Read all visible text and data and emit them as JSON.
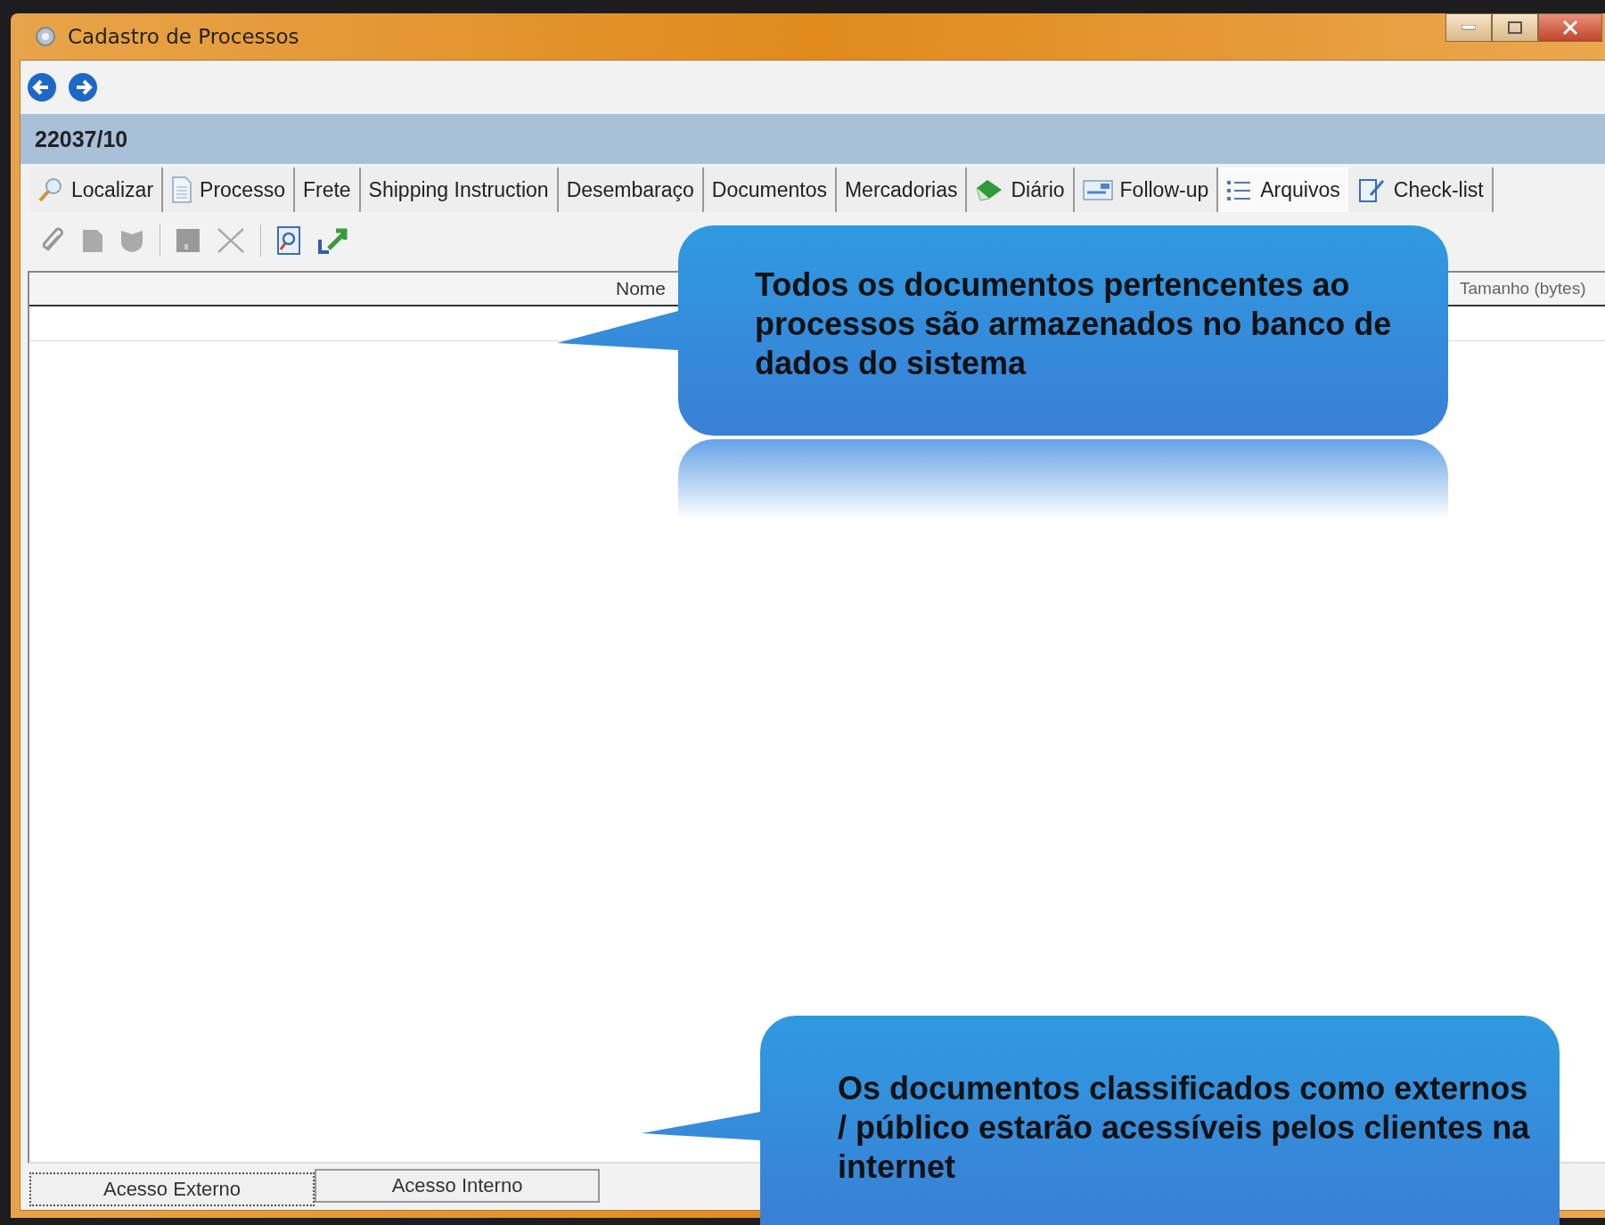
{
  "window": {
    "title": "Cadastro de Processos"
  },
  "process_number": "22037/10",
  "tabs": [
    {
      "label": "Localizar",
      "selected": false
    },
    {
      "label": "Processo",
      "selected": false
    },
    {
      "label": "Frete",
      "selected": false
    },
    {
      "label": "Shipping Instruction",
      "selected": false
    },
    {
      "label": "Desembaraço",
      "selected": false
    },
    {
      "label": "Documentos",
      "selected": false
    },
    {
      "label": "Mercadorias",
      "selected": false
    },
    {
      "label": "Diário",
      "selected": false
    },
    {
      "label": "Follow-up",
      "selected": false
    },
    {
      "label": "Arquivos",
      "selected": true
    },
    {
      "label": "Check-list",
      "selected": false
    }
  ],
  "table": {
    "columns": [
      "Nome",
      "Tamanho (bytes)"
    ]
  },
  "bottom_tabs": [
    {
      "label": "Acesso Externo",
      "selected": true
    },
    {
      "label": "Acesso Interno",
      "selected": false
    }
  ],
  "callouts": [
    "Todos os documentos pertencentes ao processos são armazenados no banco de dados do sistema",
    "Os documentos classificados como externos / público estarão acessíveis pelos clientes na internet"
  ]
}
